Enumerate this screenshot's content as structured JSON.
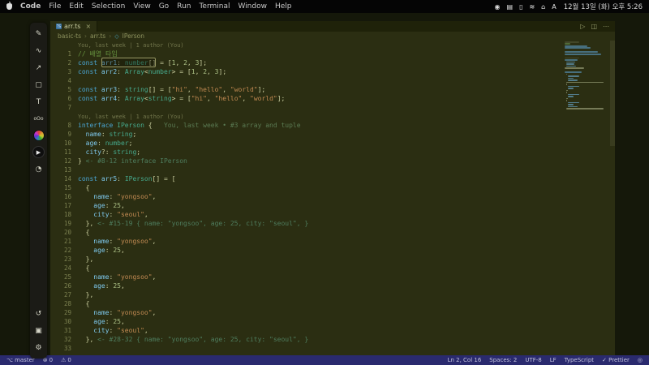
{
  "menu_bar": {
    "items": [
      "Code",
      "File",
      "Edit",
      "Selection",
      "View",
      "Go",
      "Run",
      "Terminal",
      "Window",
      "Help"
    ],
    "status_icons": [
      {
        "name": "screen-record-icon",
        "glyph": "◉"
      },
      {
        "name": "display-icon",
        "glyph": "▤"
      },
      {
        "name": "battery-icon",
        "glyph": "▯"
      },
      {
        "name": "wifi-icon",
        "glyph": "≋"
      },
      {
        "name": "control-center-icon",
        "glyph": "⌂"
      },
      {
        "name": "input-source-icon",
        "glyph": "A"
      }
    ],
    "clock": "12월 13일 (화) 오후 5:26"
  },
  "toolbar": {
    "tools": [
      {
        "name": "pen-tool-icon",
        "glyph": "✎"
      },
      {
        "name": "highlighter-tool-icon",
        "glyph": "∿"
      },
      {
        "name": "arrow-tool-icon",
        "glyph": "↗"
      },
      {
        "name": "rectangle-tool-icon",
        "glyph": "▢"
      },
      {
        "name": "text-tool-icon",
        "glyph": "T"
      },
      {
        "name": "pointer-size-tool-icon",
        "glyph": "oOo",
        "cls": "small"
      },
      {
        "name": "color-wheel-icon",
        "cls": "wheel"
      },
      {
        "name": "record-play-button",
        "glyph": "▶",
        "cls": "play"
      },
      {
        "name": "timer-icon",
        "glyph": "◔"
      },
      {
        "name": "undo-icon",
        "glyph": "↺",
        "cls": "gap"
      },
      {
        "name": "screenshot-icon",
        "glyph": "▣"
      },
      {
        "name": "settings-gear-icon",
        "glyph": "⚙"
      }
    ]
  },
  "window": {
    "tab_label": "arr.ts",
    "tab_icon": "TS",
    "close_glyph": "×",
    "editor_actions": [
      {
        "name": "run-button",
        "glyph": "▷"
      },
      {
        "name": "split-editor-button",
        "glyph": "◫"
      },
      {
        "name": "more-actions-button",
        "glyph": "⋯"
      }
    ],
    "breadcrumb": {
      "items": [
        "basic-ts",
        "arr.ts",
        "IPerson"
      ],
      "separator": "›",
      "symbol_glyph": "◇"
    }
  },
  "editor": {
    "rows": [
      {
        "lens": "You, last week | 1 author (You)"
      },
      {
        "num": 1,
        "t": [
          [
            "// 배열 타입",
            "cm"
          ]
        ]
      },
      {
        "num": 2,
        "box": {
          "s": 6,
          "l": 14
        },
        "t": [
          [
            "const ",
            "kw"
          ],
          [
            "arr1",
            "vr"
          ],
          [
            ": ",
            "pn"
          ],
          [
            "number",
            "ty"
          ],
          [
            "[]",
            "pn"
          ],
          [
            " = [",
            "pn"
          ],
          [
            "1",
            "nm"
          ],
          [
            ", ",
            "pn"
          ],
          [
            "2",
            "nm"
          ],
          [
            ", ",
            "pn"
          ],
          [
            "3",
            "nm"
          ],
          [
            "];",
            "pn"
          ]
        ]
      },
      {
        "num": 3,
        "t": [
          [
            "const ",
            "kw"
          ],
          [
            "arr2",
            "vr"
          ],
          [
            ": ",
            "pn"
          ],
          [
            "Array",
            "ty"
          ],
          [
            "<",
            "pn"
          ],
          [
            "number",
            "ty"
          ],
          [
            ">",
            "pn"
          ],
          [
            " = [",
            "pn"
          ],
          [
            "1",
            "nm"
          ],
          [
            ", ",
            "pn"
          ],
          [
            "2",
            "nm"
          ],
          [
            ", ",
            "pn"
          ],
          [
            "3",
            "nm"
          ],
          [
            "];",
            "pn"
          ]
        ]
      },
      {
        "num": 4,
        "t": []
      },
      {
        "num": 5,
        "t": [
          [
            "const ",
            "kw"
          ],
          [
            "arr3",
            "vr"
          ],
          [
            ": ",
            "pn"
          ],
          [
            "string",
            "ty"
          ],
          [
            "[]",
            "pn"
          ],
          [
            " = [",
            "pn"
          ],
          [
            "\"hi\"",
            "st"
          ],
          [
            ", ",
            "pn"
          ],
          [
            "\"hello\"",
            "st"
          ],
          [
            ", ",
            "pn"
          ],
          [
            "\"world\"",
            "st"
          ],
          [
            "];",
            "pn"
          ]
        ]
      },
      {
        "num": 6,
        "t": [
          [
            "const ",
            "kw"
          ],
          [
            "arr4",
            "vr"
          ],
          [
            ": ",
            "pn"
          ],
          [
            "Array",
            "ty"
          ],
          [
            "<",
            "pn"
          ],
          [
            "string",
            "ty"
          ],
          [
            ">",
            "pn"
          ],
          [
            " = [",
            "pn"
          ],
          [
            "\"hi\"",
            "st"
          ],
          [
            ", ",
            "pn"
          ],
          [
            "\"hello\"",
            "st"
          ],
          [
            ", ",
            "pn"
          ],
          [
            "\"world\"",
            "st"
          ],
          [
            "];",
            "pn"
          ]
        ]
      },
      {
        "num": 7,
        "t": []
      },
      {
        "lens": "You, last week | 1 author (You)"
      },
      {
        "num": 8,
        "ghost": "You, last week • #3 array and tuple",
        "t": [
          [
            "interface ",
            "kw"
          ],
          [
            "IPerson",
            "ty"
          ],
          [
            " {",
            "pn"
          ]
        ]
      },
      {
        "num": 9,
        "t": [
          [
            "  ",
            "pn"
          ],
          [
            "name",
            "vr"
          ],
          [
            ": ",
            "pn"
          ],
          [
            "string",
            "ty"
          ],
          [
            ";",
            "pn"
          ]
        ]
      },
      {
        "num": 10,
        "t": [
          [
            "  ",
            "pn"
          ],
          [
            "age",
            "vr"
          ],
          [
            ": ",
            "pn"
          ],
          [
            "number",
            "ty"
          ],
          [
            ";",
            "pn"
          ]
        ]
      },
      {
        "num": 11,
        "t": [
          [
            "  ",
            "pn"
          ],
          [
            "city",
            "vr"
          ],
          [
            "?: ",
            "pn"
          ],
          [
            "string",
            "ty"
          ],
          [
            ";",
            "pn"
          ]
        ]
      },
      {
        "num": 12,
        "t": [
          [
            "} ",
            "pn"
          ],
          [
            "<- #8-12 interface IPerson",
            "hint"
          ]
        ]
      },
      {
        "num": 13,
        "t": []
      },
      {
        "num": 14,
        "t": [
          [
            "const ",
            "kw"
          ],
          [
            "arr5",
            "vr"
          ],
          [
            ": ",
            "pn"
          ],
          [
            "IPerson",
            "ty"
          ],
          [
            "[]",
            "pn"
          ],
          [
            " = [",
            "pn"
          ]
        ]
      },
      {
        "num": 15,
        "t": [
          [
            "  {",
            "pn"
          ]
        ]
      },
      {
        "num": 16,
        "t": [
          [
            "    ",
            "pn"
          ],
          [
            "name",
            "vr"
          ],
          [
            ": ",
            "pn"
          ],
          [
            "\"yongsoo\"",
            "st"
          ],
          [
            ",",
            "pn"
          ]
        ]
      },
      {
        "num": 17,
        "t": [
          [
            "    ",
            "pn"
          ],
          [
            "age",
            "vr"
          ],
          [
            ": ",
            "pn"
          ],
          [
            "25",
            "nm"
          ],
          [
            ",",
            "pn"
          ]
        ]
      },
      {
        "num": 18,
        "t": [
          [
            "    ",
            "pn"
          ],
          [
            "city",
            "vr"
          ],
          [
            ": ",
            "pn"
          ],
          [
            "\"seoul\"",
            "st"
          ],
          [
            ",",
            "pn"
          ]
        ]
      },
      {
        "num": 19,
        "t": [
          [
            "  }, ",
            "pn"
          ],
          [
            "<- #15-19 { name: \"yongsoo\", age: 25, city: \"seoul\", }",
            "hint"
          ]
        ]
      },
      {
        "num": 20,
        "t": [
          [
            "  {",
            "pn"
          ]
        ]
      },
      {
        "num": 21,
        "t": [
          [
            "    ",
            "pn"
          ],
          [
            "name",
            "vr"
          ],
          [
            ": ",
            "pn"
          ],
          [
            "\"yongsoo\"",
            "st"
          ],
          [
            ",",
            "pn"
          ]
        ]
      },
      {
        "num": 22,
        "t": [
          [
            "    ",
            "pn"
          ],
          [
            "age",
            "vr"
          ],
          [
            ": ",
            "pn"
          ],
          [
            "25",
            "nm"
          ],
          [
            ",",
            "pn"
          ]
        ]
      },
      {
        "num": 23,
        "t": [
          [
            "  },",
            "pn"
          ]
        ]
      },
      {
        "num": 24,
        "t": [
          [
            "  {",
            "pn"
          ]
        ]
      },
      {
        "num": 25,
        "t": [
          [
            "    ",
            "pn"
          ],
          [
            "name",
            "vr"
          ],
          [
            ": ",
            "pn"
          ],
          [
            "\"yongsoo\"",
            "st"
          ],
          [
            ",",
            "pn"
          ]
        ]
      },
      {
        "num": 26,
        "t": [
          [
            "    ",
            "pn"
          ],
          [
            "age",
            "vr"
          ],
          [
            ": ",
            "pn"
          ],
          [
            "25",
            "nm"
          ],
          [
            ",",
            "pn"
          ]
        ]
      },
      {
        "num": 27,
        "t": [
          [
            "  },",
            "pn"
          ]
        ]
      },
      {
        "num": 28,
        "t": [
          [
            "  {",
            "pn"
          ]
        ]
      },
      {
        "num": 29,
        "t": [
          [
            "    ",
            "pn"
          ],
          [
            "name",
            "vr"
          ],
          [
            ": ",
            "pn"
          ],
          [
            "\"yongsoo\"",
            "st"
          ],
          [
            ",",
            "pn"
          ]
        ]
      },
      {
        "num": 30,
        "t": [
          [
            "    ",
            "pn"
          ],
          [
            "age",
            "vr"
          ],
          [
            ": ",
            "pn"
          ],
          [
            "25",
            "nm"
          ],
          [
            ",",
            "pn"
          ]
        ]
      },
      {
        "num": 31,
        "t": [
          [
            "    ",
            "pn"
          ],
          [
            "city",
            "vr"
          ],
          [
            ": ",
            "pn"
          ],
          [
            "\"seoul\"",
            "st"
          ],
          [
            ",",
            "pn"
          ]
        ]
      },
      {
        "num": 32,
        "t": [
          [
            "  }, ",
            "pn"
          ],
          [
            "<- #28-32 { name: \"yongsoo\", age: 25, city: \"seoul\", }",
            "hint"
          ]
        ]
      },
      {
        "num": 33,
        "t": []
      }
    ]
  },
  "status_bar": {
    "left": [
      {
        "name": "branch-item",
        "glyph": "⌥",
        "label": "master"
      },
      {
        "name": "errors-item",
        "glyph": "⊗",
        "label": "0"
      },
      {
        "name": "warnings-item",
        "glyph": "⚠",
        "label": "0"
      }
    ],
    "right": [
      {
        "name": "cursor-position",
        "label": "Ln 2, Col 16"
      },
      {
        "name": "indentation",
        "label": "Spaces: 2"
      },
      {
        "name": "encoding",
        "label": "UTF-8"
      },
      {
        "name": "eol",
        "label": "LF"
      },
      {
        "name": "language-mode",
        "label": "TypeScript"
      },
      {
        "name": "formatter",
        "label": "✓ Prettier"
      },
      {
        "name": "notifications-bell",
        "label": "◎"
      }
    ]
  }
}
